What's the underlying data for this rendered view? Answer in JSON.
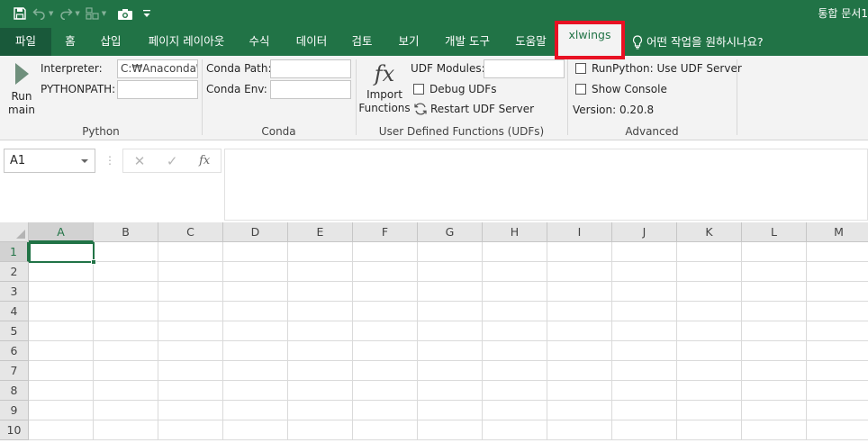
{
  "window": {
    "title": "통합 문서1"
  },
  "quick_access": {
    "items": [
      "save-icon",
      "undo-icon",
      "redo-icon",
      "touch-mode-icon",
      "camera-icon",
      "customize-icon"
    ]
  },
  "tabs": [
    {
      "label": "파일",
      "id": "file"
    },
    {
      "label": "홈",
      "id": "home"
    },
    {
      "label": "삽입",
      "id": "insert"
    },
    {
      "label": "페이지 레이아웃",
      "id": "page-layout"
    },
    {
      "label": "수식",
      "id": "formulas"
    },
    {
      "label": "데이터",
      "id": "data"
    },
    {
      "label": "검토",
      "id": "review"
    },
    {
      "label": "보기",
      "id": "view"
    },
    {
      "label": "개발 도구",
      "id": "developer"
    },
    {
      "label": "도움말",
      "id": "help"
    },
    {
      "label": "xlwings",
      "id": "xlwings",
      "active": true
    }
  ],
  "tell_me": {
    "label": "어떤 작업을 원하시나요?"
  },
  "ribbon": {
    "python": {
      "run_label_1": "Run",
      "run_label_2": "main",
      "interpreter_label": "Interpreter:",
      "interpreter_value": "C:₩Anaconda₩|",
      "pythonpath_label": "PYTHONPATH:",
      "pythonpath_value": "",
      "group_label": "Python"
    },
    "conda": {
      "path_label": "Conda Path:",
      "path_value": "",
      "env_label": "Conda Env:",
      "env_value": "",
      "group_label": "Conda"
    },
    "udf": {
      "import_label_1": "Import",
      "import_label_2": "Functions",
      "fx_glyph": "fx",
      "modules_label": "UDF Modules:",
      "modules_value": "",
      "debug_label": "Debug UDFs",
      "restart_label": "Restart UDF Server",
      "group_label": "User Defined Functions (UDFs)"
    },
    "advanced": {
      "runpython_label": "RunPython: Use UDF Server",
      "console_label": "Show Console",
      "version_label": "Version: 0.20.8",
      "group_label": "Advanced"
    }
  },
  "formula_bar": {
    "name_box": "A1",
    "formula": "",
    "fx_label": "fx"
  },
  "sheet": {
    "columns": [
      "A",
      "B",
      "C",
      "D",
      "E",
      "F",
      "G",
      "H",
      "I",
      "J",
      "K",
      "L",
      "M"
    ],
    "rows": [
      "1",
      "2",
      "3",
      "4",
      "5",
      "6",
      "7",
      "8",
      "9",
      "10"
    ],
    "selected": "A1"
  },
  "colors": {
    "excel_green": "#217346",
    "highlight_red": "#e81123",
    "ribbon_bg": "#f3f3f3"
  }
}
